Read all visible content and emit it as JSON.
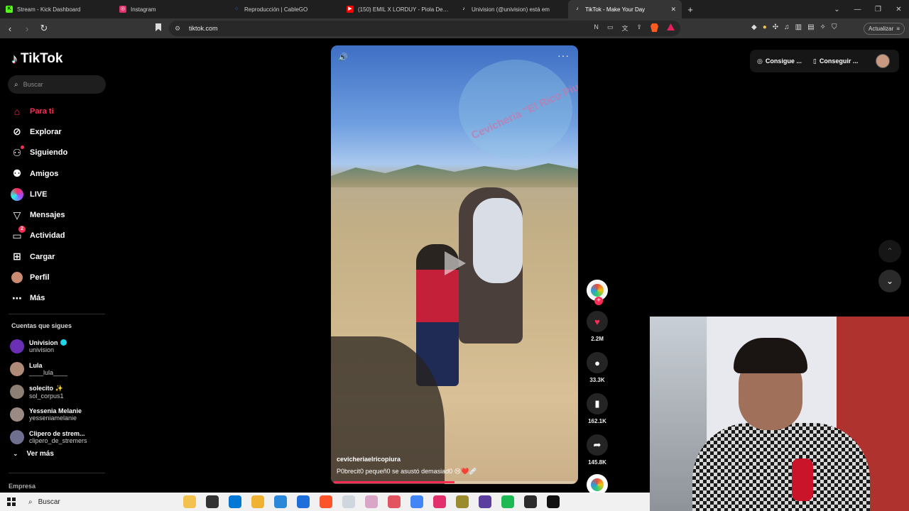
{
  "browser": {
    "tabs": [
      {
        "label": "Stream - Kick Dashboard",
        "favicon": "K",
        "color": "#53fc18",
        "active": false
      },
      {
        "label": "Instagram",
        "favicon": "◎",
        "color": "#e1306c",
        "active": false
      },
      {
        "label": "Reproducción | CableGO",
        "favicon": "○",
        "color": "#2d7ff9",
        "active": false
      },
      {
        "label": "(150) EMIL X LORDUY - Piola De Fla",
        "favicon": "▶",
        "color": "#ff0000",
        "active": false
      },
      {
        "label": "Univision (@univision) está em",
        "favicon": "♪",
        "color": "#111111",
        "active": false
      },
      {
        "label": "TikTok - Make Your Day",
        "favicon": "♪",
        "color": "#111111",
        "active": true
      }
    ],
    "new_tab": "+",
    "url": "tiktok.com",
    "update_label": "Actualizar",
    "window": {
      "minimize": "—",
      "restore": "❐",
      "close": "✕",
      "chevron": "⌄"
    }
  },
  "sidebar": {
    "logo": "TikTok",
    "search_placeholder": "Buscar",
    "nav": [
      {
        "label": "Para ti",
        "icon": "home-icon",
        "glyph": "⌂",
        "active": true
      },
      {
        "label": "Explorar",
        "icon": "compass-icon",
        "glyph": "⊘",
        "active": false
      },
      {
        "label": "Siguiendo",
        "icon": "following-icon",
        "glyph": "⚇",
        "active": false
      },
      {
        "label": "Amigos",
        "icon": "friends-icon",
        "glyph": "⚉",
        "active": false
      },
      {
        "label": "LIVE",
        "icon": "live-icon",
        "glyph": "",
        "active": false
      },
      {
        "label": "Mensajes",
        "icon": "messages-icon",
        "glyph": "▽",
        "active": false
      },
      {
        "label": "Actividad",
        "icon": "activity-icon",
        "glyph": "▭",
        "active": false,
        "badge": "2"
      },
      {
        "label": "Cargar",
        "icon": "upload-icon",
        "glyph": "⊞",
        "active": false
      },
      {
        "label": "Perfil",
        "icon": "profile-icon",
        "glyph": "",
        "active": false
      },
      {
        "label": "Más",
        "icon": "more-icon",
        "glyph": "⋯",
        "active": false
      }
    ],
    "following_title": "Cuentas que sigues",
    "following": [
      {
        "name": "Univision",
        "user": "univision",
        "verified": true,
        "color": "#6a2fb5"
      },
      {
        "name": "Lula",
        "user": "____lula____",
        "verified": false,
        "color": "#b08a78"
      },
      {
        "name": "solecito ✨",
        "user": "sol_corpus1",
        "verified": false,
        "color": "#8d7f73"
      },
      {
        "name": "Yessenia Melanie",
        "user": "yesseniamelanie",
        "verified": false,
        "color": "#9b8a83"
      },
      {
        "name": "Clipero de strem...",
        "user": "clipero_de_stremers",
        "verified": false,
        "color": "#6f6f8f"
      }
    ],
    "see_more": "Ver más",
    "company": "Empresa"
  },
  "video": {
    "watermark": "Cevicheria \"El Rico Piura\"",
    "author": "cevicheriaelricopiura",
    "caption": "P0brecit0 pequeñ0 se asustó demasiad0 😢❤️🩹",
    "progress_percent": 50,
    "mute_icon": "🔊",
    "more_icon": "···"
  },
  "actions": {
    "follow_plus": "+",
    "likes": "2.2M",
    "comments": "33.3K",
    "saves": "162.1K",
    "shares": "145.8K",
    "like_glyph": "♥",
    "comment_glyph": "●",
    "save_glyph": "▮",
    "share_glyph": "➦"
  },
  "topright": {
    "get_coins": "Consigue ...",
    "get_app": "Conseguir ..."
  },
  "scroll": {
    "up": "⌃",
    "down": "⌄"
  },
  "taskbar": {
    "search_label": "Buscar",
    "apps": [
      "#f2c14e",
      "#333333",
      "#0078d4",
      "#f0b232",
      "#2b88d8",
      "#1e6fd9",
      "#fb542b",
      "#cfd6de",
      "#d9a6c8",
      "#e2545f",
      "#4285f4",
      "#e1306c",
      "#9a8b2e",
      "#5b3f9e",
      "#1db954",
      "#2c2c2c",
      "#111111"
    ]
  }
}
